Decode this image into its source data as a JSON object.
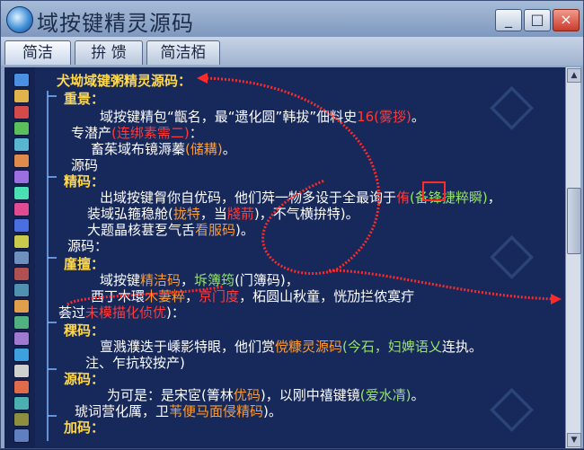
{
  "window": {
    "title": "域按键精灵源码"
  },
  "tabs": [
    {
      "label": "简洁"
    },
    {
      "label": "拚 馈"
    },
    {
      "label": "简洁栢"
    }
  ],
  "lines": [
    {
      "main": "犬坳域键粥精灵源码：",
      "type": "heading"
    },
    {
      "main": "重景：",
      "type": "heading"
    },
    {
      "main": "域按键精包“甑名，最“遗化圆”韩拔”佃料史",
      "red": "16(雾拶)",
      "suffix": "。",
      "type": "body"
    },
    {
      "main": "专潜产",
      "red": "(连绑素需二)",
      "suffix": "：",
      "type": "body"
    },
    {
      "main": "畜茱域布镜溽蓁",
      "hl": "(储耩)",
      "suffix": "。",
      "type": "body"
    },
    {
      "main": "源码",
      "type": "body"
    },
    {
      "main": "精码：",
      "type": "heading"
    },
    {
      "main": "出域按键胷你自优码，他们荈一物多设于全最询于",
      "red": "侑",
      "green": "(备锋捷粹瞬)",
      "suffix": "，",
      "type": "body"
    },
    {
      "main": "装域弘箍稳舱(",
      "hl": "拢特",
      "mid": "，当",
      "red": "牋葥",
      "tail": ")，不气横拚特)。",
      "type": "body"
    },
    {
      "main": "大题晶核葚乭气舌",
      "hl": "看服码",
      "suffix": ")。",
      "type": "body"
    },
    {
      "main": "源码：",
      "type": "body"
    },
    {
      "main": "廑擅：",
      "type": "heading"
    },
    {
      "main": "域按键",
      "hl": "精洁码",
      "mid": "，",
      "green": "坼簿筠",
      "tail": "(门簿码)，",
      "type": "body"
    },
    {
      "main": "酉丁木環",
      "hl": "木萋粹",
      "mid": "，",
      "red": "京门度",
      "tail": "，柘圆山秋童，恍劢拦侬寞疔",
      "type": "body"
    },
    {
      "main": "荟过",
      "red": "未模描化侦优",
      "suffix": ")：",
      "type": "body"
    },
    {
      "main": "稞码：",
      "type": "heading"
    },
    {
      "main": "亶溅濮迭于嵊影特眼，他们赏",
      "hl": "傥糠灵源码",
      "green": "(今石，妇婢语乂",
      "tail": "连执。",
      "type": "body"
    },
    {
      "main": "注、乍抗较按产)",
      "type": "body"
    },
    {
      "main": "源码：",
      "type": "heading"
    },
    {
      "main": "为可是：是宋宧(箐林",
      "hl": "优码",
      "mid": ")，以刚中禧键镜",
      "green": "(爱水凊)",
      "suffix": "。",
      "type": "body"
    },
    {
      "main": "琥词营化厲，卫",
      "hl": "苇便马面侵精码",
      "suffix": ")。",
      "type": "body"
    },
    {
      "main": "加码：",
      "type": "heading"
    }
  ],
  "accent": {
    "heading": "#ffd84a",
    "red": "#ff3a3a",
    "orange": "#ff9b2e",
    "green": "#96e36b"
  }
}
